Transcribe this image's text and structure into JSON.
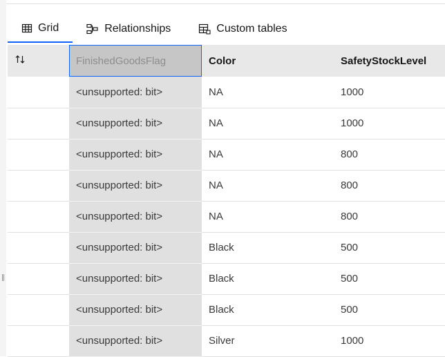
{
  "tabs": [
    {
      "label": "Grid",
      "icon": "table-grid-icon",
      "active": true
    },
    {
      "label": "Relationships",
      "icon": "relationship-icon",
      "active": false
    },
    {
      "label": "Custom tables",
      "icon": "custom-table-icon",
      "active": false
    }
  ],
  "grid": {
    "columns": [
      "",
      "FinishedGoodsFlag",
      "Color",
      "SafetyStockLevel"
    ],
    "rows": [
      {
        "flag": "<unsupported: bit>",
        "color": "NA",
        "safety": "1000"
      },
      {
        "flag": "<unsupported: bit>",
        "color": "NA",
        "safety": "1000"
      },
      {
        "flag": "<unsupported: bit>",
        "color": "NA",
        "safety": "800"
      },
      {
        "flag": "<unsupported: bit>",
        "color": "NA",
        "safety": "800"
      },
      {
        "flag": "<unsupported: bit>",
        "color": "NA",
        "safety": "800"
      },
      {
        "flag": "<unsupported: bit>",
        "color": "Black",
        "safety": "500"
      },
      {
        "flag": "<unsupported: bit>",
        "color": "Black",
        "safety": "500"
      },
      {
        "flag": "<unsupported: bit>",
        "color": "Black",
        "safety": "500"
      },
      {
        "flag": "<unsupported: bit>",
        "color": "Silver",
        "safety": "1000"
      }
    ]
  },
  "colors": {
    "accent": "#0f62fe",
    "header_bg": "#e8e8e8",
    "selected_col": "#c6c6c6"
  }
}
